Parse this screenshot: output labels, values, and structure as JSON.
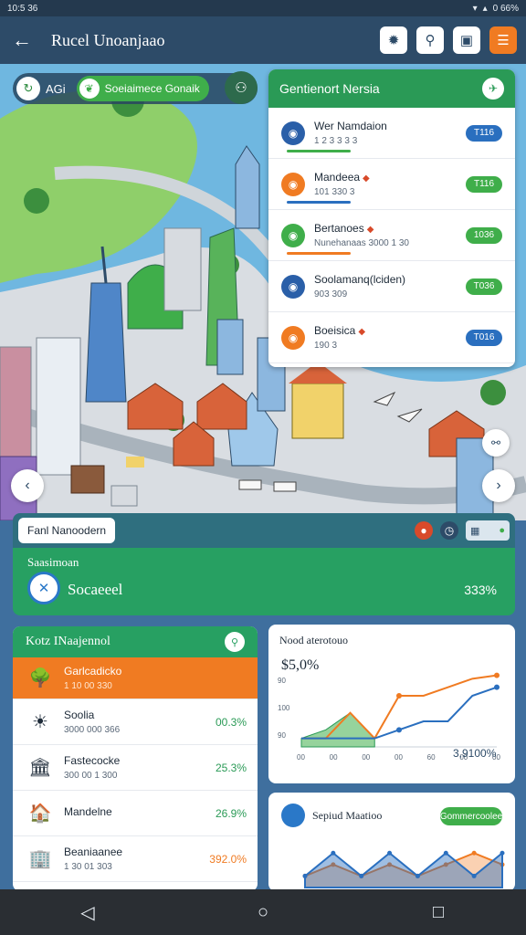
{
  "status": {
    "time": "10:5 36",
    "battery": "0 66%"
  },
  "appbar": {
    "title": "Rucel Unoanjaao",
    "back_icon": "arrow-left-icon",
    "actions": [
      "settings-icon",
      "search-icon",
      "vehicle-icon",
      "menu-icon"
    ]
  },
  "map_chips": {
    "chip_a": "AGi",
    "chip_b": "Soeiaimece Gonaik"
  },
  "panel": {
    "title": "Gentienort Nersia",
    "rows": [
      {
        "name": "Wer Namdaion",
        "sub": "1 2 3 3 3 3",
        "pill": "T116",
        "ring": "#2a5fa8",
        "pill_color": "#2a6fbf",
        "bar_color": "#3fae4a",
        "mark": ""
      },
      {
        "name": "Mandeea",
        "sub": "101 330 3",
        "pill": "T116",
        "ring": "#f07b22",
        "pill_color": "#3fae4a",
        "bar_color": "#2a6fbf",
        "mark": "◆"
      },
      {
        "name": "Bertanoes",
        "sub": "Nunehanaas 3000 1 30",
        "pill": "1036",
        "ring": "#3fae4a",
        "pill_color": "#3fae4a",
        "bar_color": "#f07b22",
        "mark": "◆"
      },
      {
        "name": "Soolamanq(lciden)",
        "sub": "903 309",
        "pill": "T036",
        "ring": "#2a5fa8",
        "pill_color": "#3fae4a",
        "bar_color": "",
        "mark": ""
      },
      {
        "name": "Boeisica",
        "sub": "190 3",
        "pill": "T016",
        "ring": "#f07b22",
        "pill_color": "#2a6fbf",
        "bar_color": "",
        "mark": "◆"
      }
    ]
  },
  "location": {
    "label": "Fanl Nanoodern"
  },
  "summary": {
    "label": "Saasimoan",
    "value": "Socaeeel",
    "percent": "333%"
  },
  "list_card": {
    "title": "Kotz INaajennol",
    "rows": [
      {
        "name": "Garlcadicko",
        "sub": "1 10 00 330",
        "value": "",
        "thumb": "🌳"
      },
      {
        "name": "Soolia",
        "sub": "3000 000 366",
        "value": "00.3%",
        "thumb": "☀"
      },
      {
        "name": "Fastecocke",
        "sub": "300 00 1 300",
        "value": "25.3%",
        "thumb": "🏛"
      },
      {
        "name": "Mandelne",
        "sub": "",
        "value": "26.9%",
        "thumb": "🏠"
      },
      {
        "name": "Beaniaanee",
        "sub": "1 30 01 303",
        "value": "392.0%",
        "thumb": "🏢"
      }
    ]
  },
  "chart_card": {
    "title": "Nood aterotouo",
    "value": "$5,0%",
    "note": "3,9100%"
  },
  "chart_data": {
    "type": "line",
    "x": [
      0,
      1,
      2,
      3,
      4,
      5,
      6,
      7,
      8
    ],
    "series": [
      {
        "values": [
          1,
          1,
          4,
          1,
          6,
          6,
          7,
          8,
          8.4
        ]
      },
      {
        "values": [
          1,
          1,
          1,
          1,
          2,
          3,
          3,
          6,
          7
        ]
      }
    ],
    "area_values": [
      1,
      2,
      4,
      1
    ],
    "y_ticks": [
      "90",
      "100",
      "90"
    ],
    "x_ticks": [
      "00",
      "00",
      "00",
      "00",
      "60",
      "00",
      "00"
    ]
  },
  "bottom_card": {
    "title": "Sepiud Maatioo",
    "button": "Gommercoolee"
  },
  "bottom_chart": {
    "series_a": [
      1,
      3,
      1,
      3,
      1,
      3,
      1,
      3
    ],
    "series_b": [
      1,
      2,
      1,
      2,
      1,
      2,
      3,
      2
    ]
  },
  "navbar": {
    "back": "◁",
    "home": "○",
    "recent": "□"
  },
  "colors": {
    "green": "#27a062",
    "orange": "#f07b22",
    "blue": "#2a6fbf",
    "header": "#2d4b68"
  }
}
